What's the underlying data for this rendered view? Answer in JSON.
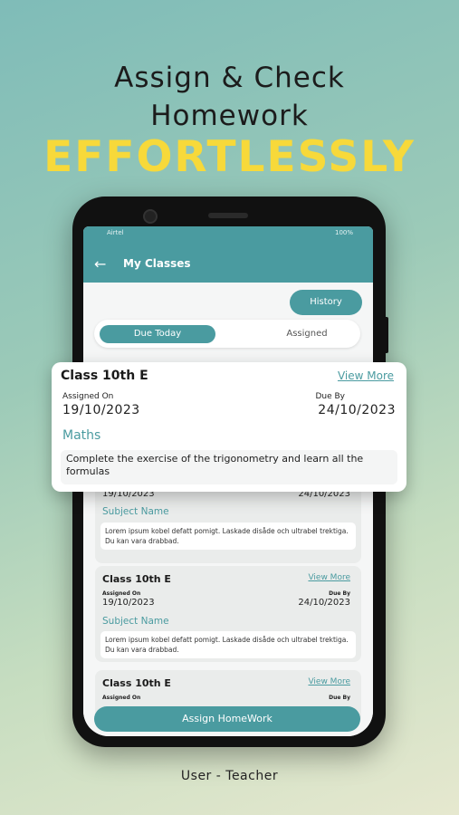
{
  "headline": {
    "line1": "Assign & Check",
    "line2": "Homework",
    "line3": "EFFORTLESSLY"
  },
  "footer": "User - Teacher",
  "status_bar": {
    "carrier": "Airtel",
    "battery": "100%"
  },
  "app_bar": {
    "title": "My Classes"
  },
  "history_label": "History",
  "tabs": [
    {
      "label": "Due Today",
      "active": true
    },
    {
      "label": "Assigned",
      "active": false
    }
  ],
  "popup_card": {
    "class_name": "Class 10th E",
    "view_more": "View More",
    "assigned_label": "Assigned On",
    "assigned_date": "19/10/2023",
    "due_label": "Due By",
    "due_date": "24/10/2023",
    "subject": "Maths",
    "description": "Complete the exercise of the trigonometry and learn all the formulas"
  },
  "cards": [
    {
      "assigned_date": "19/10/2023",
      "due_date": "24/10/2023",
      "subject": "Subject Name",
      "description": "Lorem ipsum kobel defatt pomigt. Laskade disåde och ultrabel trektiga. Du kan vara drabbad."
    },
    {
      "class_name": "Class 10th E",
      "view_more": "View More",
      "assigned_label": "Assigned On",
      "assigned_date": "19/10/2023",
      "due_label": "Due By",
      "due_date": "24/10/2023",
      "subject": "Subject Name",
      "description": "Lorem ipsum kobel defatt pomigt. Laskade disåde och ultrabel trektiga. Du kan vara drabbad."
    },
    {
      "class_name": "Class 10th E",
      "view_more": "View More",
      "assigned_label": "Assigned On",
      "due_label": "Due By"
    }
  ],
  "assign_button": "Assign HomeWork",
  "colors": {
    "accent": "#4a9ba0",
    "headline_yellow": "#f7d93a"
  }
}
